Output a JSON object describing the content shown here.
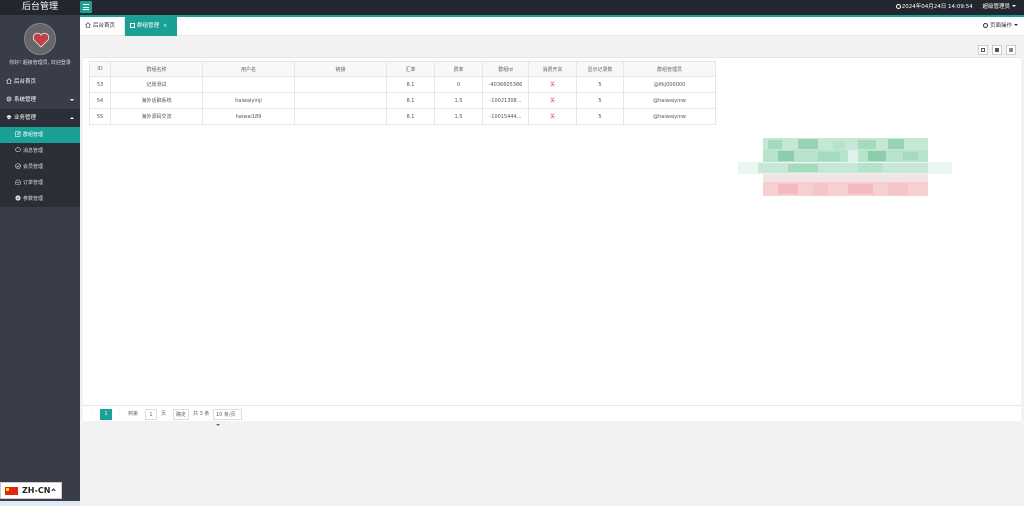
{
  "app": {
    "logo_title": "后台管理",
    "datetime": "2024年04月24日 14:09:54",
    "admin_label": "超级管理员"
  },
  "sidebar": {
    "welcome": "你好! 超级管理员, 欢迎登录",
    "home": "后台首页",
    "system": "系统管理",
    "business": "业务管理",
    "sub_items": [
      "群组管理",
      "消息管理",
      "会员管理",
      "订单管理",
      "参数管理"
    ]
  },
  "tabs": {
    "home": "后台首页",
    "active": "群组管理",
    "close": "×",
    "page_ops": "页面操作"
  },
  "table": {
    "headers": [
      "ID",
      "群组名称",
      "用户名",
      "链接",
      "汇率",
      "费率",
      "群组id",
      "消费开关",
      "显示记录数",
      "群组管理员"
    ],
    "rows": [
      [
        "53",
        "记账测试",
        "",
        "",
        "8.1",
        "0",
        "-4036605386",
        "关",
        "5",
        "@lfkj000000"
      ],
      [
        "54",
        "海外话聊系统",
        "haiwaiyinji",
        "",
        "8.1",
        "1.5",
        "-10021308...",
        "关",
        "5",
        "@haiwaiyinw"
      ],
      [
        "55",
        "海外源码交流",
        "haiwai189",
        "",
        "8.1",
        "1.5",
        "-10015444...",
        "关",
        "5",
        "@haiwaiyinw"
      ]
    ]
  },
  "pager": {
    "prev": "‹",
    "current": "1",
    "next": "›",
    "goto": "到第",
    "page_value": "1",
    "page_unit": "页",
    "confirm": "确定",
    "total": "共 3 条",
    "page_size": "10 条/页"
  },
  "language": {
    "code": "ZH-CN"
  },
  "colors": {
    "accent": "#1aa094",
    "topbar": "#23262e",
    "sidebar": "#393d49"
  }
}
